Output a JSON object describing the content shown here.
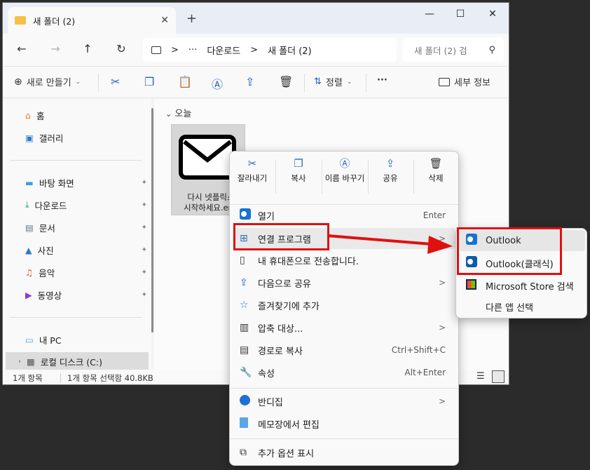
{
  "window": {
    "tab_title": "새 폴더 (2)",
    "close_tab": "✕",
    "new_tab": "+",
    "minimize": "—",
    "maximize": "☐",
    "close": "✕"
  },
  "nav_buttons": {
    "back": "←",
    "forward": "→",
    "up": "↑",
    "refresh": "↻"
  },
  "address": {
    "pc_icon": "computer-icon",
    "more": "···",
    "crumbs": [
      "다운로드",
      "새 폴더 (2)"
    ],
    "sep": ">"
  },
  "search": {
    "text": "새 폴더 (2) 검"
  },
  "toolbar": {
    "new_label": "새로 만들기",
    "sort_label": "정렬",
    "more": "···",
    "details_label": "세부 정보"
  },
  "sidebar": {
    "items": [
      {
        "label": "홈"
      },
      {
        "label": "갤러리"
      },
      {
        "label": "바탕 화면"
      },
      {
        "label": "다운로드"
      },
      {
        "label": "문서"
      },
      {
        "label": "사진"
      },
      {
        "label": "음악"
      },
      {
        "label": "동영상"
      },
      {
        "label": "내 PC"
      },
      {
        "label": "로컬 디스크 (C:)"
      }
    ],
    "pin": "📌"
  },
  "content": {
    "group": "오늘",
    "file_name_line1": "다시 넷플릭스",
    "file_name_line2": "시작하세요.eml"
  },
  "status": {
    "count": "1개 항목",
    "selected": "1개 항목 선택함 40.8KB"
  },
  "context_menu": {
    "quick_actions": [
      "잘라내기",
      "복사",
      "이름 바꾸기",
      "공유",
      "삭제"
    ],
    "items": [
      {
        "label": "열기",
        "shortcut": "Enter"
      },
      {
        "label": "연결 프로그램",
        "arrow": ">"
      },
      {
        "label": "내 휴대폰으로 전송합니다."
      },
      {
        "label": "다음으로 공유",
        "arrow": ">"
      },
      {
        "label": "즐겨찾기에 추가"
      },
      {
        "label": "압축 대상...",
        "arrow": ">"
      },
      {
        "label": "경로로 복사",
        "shortcut": "Ctrl+Shift+C"
      },
      {
        "label": "속성",
        "shortcut": "Alt+Enter"
      },
      {
        "label": "반디집",
        "arrow": ">"
      },
      {
        "label": "메모장에서 편집"
      },
      {
        "label": "추가 옵션 표시"
      }
    ]
  },
  "submenu": {
    "items": [
      {
        "label": "Outlook"
      },
      {
        "label": "Outlook(클래식)"
      },
      {
        "label": "Microsoft Store 검색"
      },
      {
        "label": "다른 앱 선택"
      }
    ]
  },
  "colors": {
    "highlight": "#e01010",
    "accent": "#2a6cc0"
  }
}
